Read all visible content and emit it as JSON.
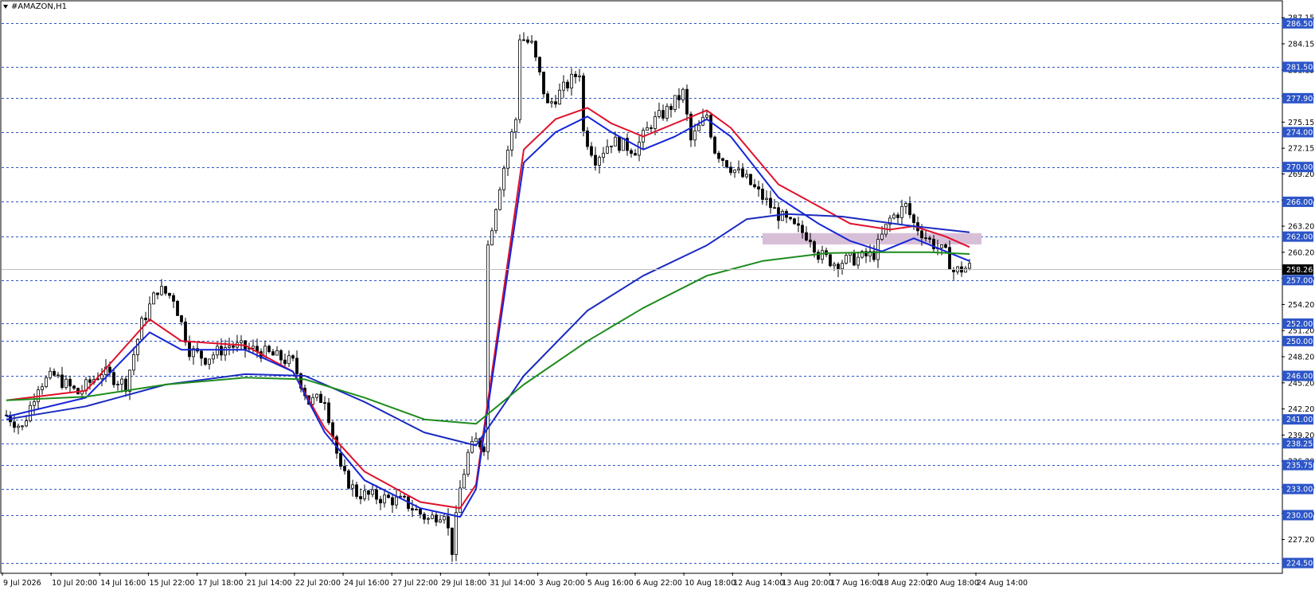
{
  "symbol": "#AMAZON,H1",
  "chart_data": {
    "type": "candlestick",
    "instrument": "#AMAZON",
    "timeframe": "H1",
    "current_price": "258.26",
    "ylim": [
      223.5,
      289
    ],
    "y_ticks": [
      "287.15",
      "284.15",
      "281.15",
      "278.15",
      "275.15",
      "272.15",
      "269.20",
      "266.20",
      "263.20",
      "260.20",
      "257.20",
      "254.20",
      "251.20",
      "248.20",
      "245.20",
      "242.20",
      "239.20",
      "236.20",
      "233.20",
      "230.20",
      "227.20"
    ],
    "level_lines": [
      {
        "value": 286.5,
        "label": "286.50"
      },
      {
        "value": 281.5,
        "label": "281.50"
      },
      {
        "value": 277.9,
        "label": "277.90"
      },
      {
        "value": 274.0,
        "label": "274.00"
      },
      {
        "value": 270.0,
        "label": "270.00"
      },
      {
        "value": 266.0,
        "label": "266.00"
      },
      {
        "value": 262.0,
        "label": "262.00"
      },
      {
        "value": 257.0,
        "label": "257.00"
      },
      {
        "value": 252.0,
        "label": "252.00"
      },
      {
        "value": 250.0,
        "label": "250.00"
      },
      {
        "value": 246.0,
        "label": "246.00"
      },
      {
        "value": 241.0,
        "label": "241.00"
      },
      {
        "value": 238.25,
        "label": "238.25"
      },
      {
        "value": 235.75,
        "label": "235.75"
      },
      {
        "value": 233.0,
        "label": "233.00"
      },
      {
        "value": 230.0,
        "label": "230.00"
      },
      {
        "value": 224.5,
        "label": "224.50"
      }
    ],
    "zone": {
      "from_index": 190,
      "to_index": 245,
      "y_low": 261.1,
      "y_high": 262.4,
      "color": "#d8bfd8"
    },
    "x_labels": [
      "9 Jul 2026",
      "10 Jul 20:00",
      "14 Jul 16:00",
      "15 Jul 22:00",
      "17 Jul 18:00",
      "21 Jul 14:00",
      "22 Jul 20:00",
      "24 Jul 16:00",
      "27 Jul 22:00",
      "29 Jul 18:00",
      "31 Jul 14:00",
      "3 Aug 20:00",
      "5 Aug 16:00",
      "6 Aug 22:00",
      "10 Aug 18:00",
      "12 Aug 14:00",
      "13 Aug 20:00",
      "17 Aug 16:00",
      "18 Aug 22:00",
      "20 Aug 18:00",
      "24 Aug 14:00"
    ],
    "price_path": [
      [
        0,
        241.5
      ],
      [
        4,
        240.0
      ],
      [
        8,
        245.0
      ],
      [
        12,
        246.0
      ],
      [
        18,
        244.0
      ],
      [
        24,
        246.5
      ],
      [
        30,
        245.0
      ],
      [
        34,
        252.0
      ],
      [
        38,
        256.0
      ],
      [
        42,
        255.0
      ],
      [
        46,
        249.0
      ],
      [
        50,
        248.0
      ],
      [
        56,
        249.5
      ],
      [
        62,
        249.0
      ],
      [
        66,
        248.5
      ],
      [
        72,
        247.5
      ],
      [
        76,
        243.0
      ],
      [
        80,
        243.5
      ],
      [
        84,
        235.0
      ],
      [
        88,
        232.5
      ],
      [
        94,
        232.0
      ],
      [
        100,
        231.5
      ],
      [
        106,
        229.5
      ],
      [
        110,
        230.5
      ],
      [
        112,
        226.0
      ],
      [
        114,
        233.0
      ],
      [
        116,
        237.0
      ],
      [
        118,
        238.5
      ],
      [
        120,
        238.0
      ],
      [
        121,
        261.0
      ],
      [
        124,
        268.0
      ],
      [
        126,
        272.0
      ],
      [
        128,
        275.5
      ],
      [
        129,
        285.0
      ],
      [
        132,
        284.0
      ],
      [
        136,
        277.0
      ],
      [
        140,
        279.0
      ],
      [
        144,
        281.0
      ],
      [
        145,
        274.0
      ],
      [
        148,
        271.0
      ],
      [
        152,
        273.0
      ],
      [
        158,
        272.0
      ],
      [
        162,
        275.0
      ],
      [
        166,
        276.5
      ],
      [
        170,
        278.5
      ],
      [
        172,
        273.0
      ],
      [
        176,
        276.0
      ],
      [
        178,
        272.0
      ],
      [
        182,
        270.0
      ],
      [
        186,
        268.5
      ],
      [
        190,
        266.5
      ],
      [
        194,
        264.5
      ],
      [
        198,
        263.0
      ],
      [
        202,
        262.0
      ],
      [
        204,
        260.0
      ],
      [
        208,
        259.0
      ],
      [
        214,
        259.5
      ],
      [
        218,
        260.0
      ],
      [
        222,
        264.0
      ],
      [
        226,
        265.5
      ],
      [
        228,
        263.5
      ],
      [
        232,
        261.5
      ],
      [
        236,
        260.0
      ],
      [
        238,
        258.0
      ],
      [
        242,
        258.5
      ]
    ],
    "series": [
      {
        "name": "",
        "color": "#e0102a",
        "values": [
          [
            0,
            243.2
          ],
          [
            20,
            244.3
          ],
          [
            36,
            252.5
          ],
          [
            44,
            250.0
          ],
          [
            60,
            249.5
          ],
          [
            72,
            246.5
          ],
          [
            80,
            240.0
          ],
          [
            90,
            235.0
          ],
          [
            104,
            231.5
          ],
          [
            114,
            230.8
          ],
          [
            118,
            233.5
          ],
          [
            130,
            272.0
          ],
          [
            138,
            275.5
          ],
          [
            146,
            276.8
          ],
          [
            152,
            275.0
          ],
          [
            160,
            273.5
          ],
          [
            168,
            275.0
          ],
          [
            176,
            276.5
          ],
          [
            182,
            274.5
          ],
          [
            194,
            268.0
          ],
          [
            204,
            265.5
          ],
          [
            212,
            263.5
          ],
          [
            222,
            262.8
          ],
          [
            228,
            263.2
          ],
          [
            236,
            262.0
          ],
          [
            242,
            260.8
          ]
        ]
      },
      {
        "name": "",
        "color": "#1525d8",
        "values": [
          [
            0,
            241.3
          ],
          [
            20,
            243.5
          ],
          [
            36,
            251.0
          ],
          [
            44,
            249.0
          ],
          [
            60,
            249.0
          ],
          [
            72,
            246.5
          ],
          [
            80,
            239.5
          ],
          [
            90,
            234.0
          ],
          [
            104,
            230.8
          ],
          [
            114,
            229.8
          ],
          [
            118,
            233.0
          ],
          [
            130,
            270.5
          ],
          [
            138,
            274.0
          ],
          [
            146,
            275.8
          ],
          [
            152,
            274.0
          ],
          [
            160,
            272.0
          ],
          [
            168,
            273.5
          ],
          [
            176,
            275.5
          ],
          [
            182,
            273.5
          ],
          [
            194,
            266.5
          ],
          [
            204,
            263.5
          ],
          [
            212,
            261.5
          ],
          [
            220,
            260.3
          ],
          [
            228,
            261.8
          ],
          [
            236,
            260.3
          ],
          [
            242,
            259.2
          ]
        ]
      },
      {
        "name": "",
        "color": "#1a2abf",
        "values": [
          [
            0,
            241.0
          ],
          [
            20,
            242.5
          ],
          [
            40,
            245.0
          ],
          [
            60,
            246.2
          ],
          [
            75,
            246.0
          ],
          [
            90,
            243.0
          ],
          [
            105,
            239.5
          ],
          [
            118,
            238.0
          ],
          [
            130,
            246.0
          ],
          [
            146,
            253.5
          ],
          [
            160,
            257.5
          ],
          [
            176,
            261.0
          ],
          [
            186,
            264.0
          ],
          [
            196,
            264.6
          ],
          [
            210,
            264.3
          ],
          [
            226,
            263.3
          ],
          [
            242,
            262.5
          ]
        ]
      },
      {
        "name": "",
        "color": "#1d8c1d",
        "values": [
          [
            0,
            243.2
          ],
          [
            20,
            243.6
          ],
          [
            40,
            245.0
          ],
          [
            60,
            245.8
          ],
          [
            75,
            245.6
          ],
          [
            90,
            243.5
          ],
          [
            105,
            241.0
          ],
          [
            118,
            240.5
          ],
          [
            130,
            245.0
          ],
          [
            146,
            250.0
          ],
          [
            160,
            253.8
          ],
          [
            176,
            257.5
          ],
          [
            190,
            259.2
          ],
          [
            206,
            260.1
          ],
          [
            220,
            260.2
          ],
          [
            232,
            260.2
          ],
          [
            242,
            260.0
          ]
        ]
      }
    ],
    "grid": false,
    "legend": "none"
  }
}
